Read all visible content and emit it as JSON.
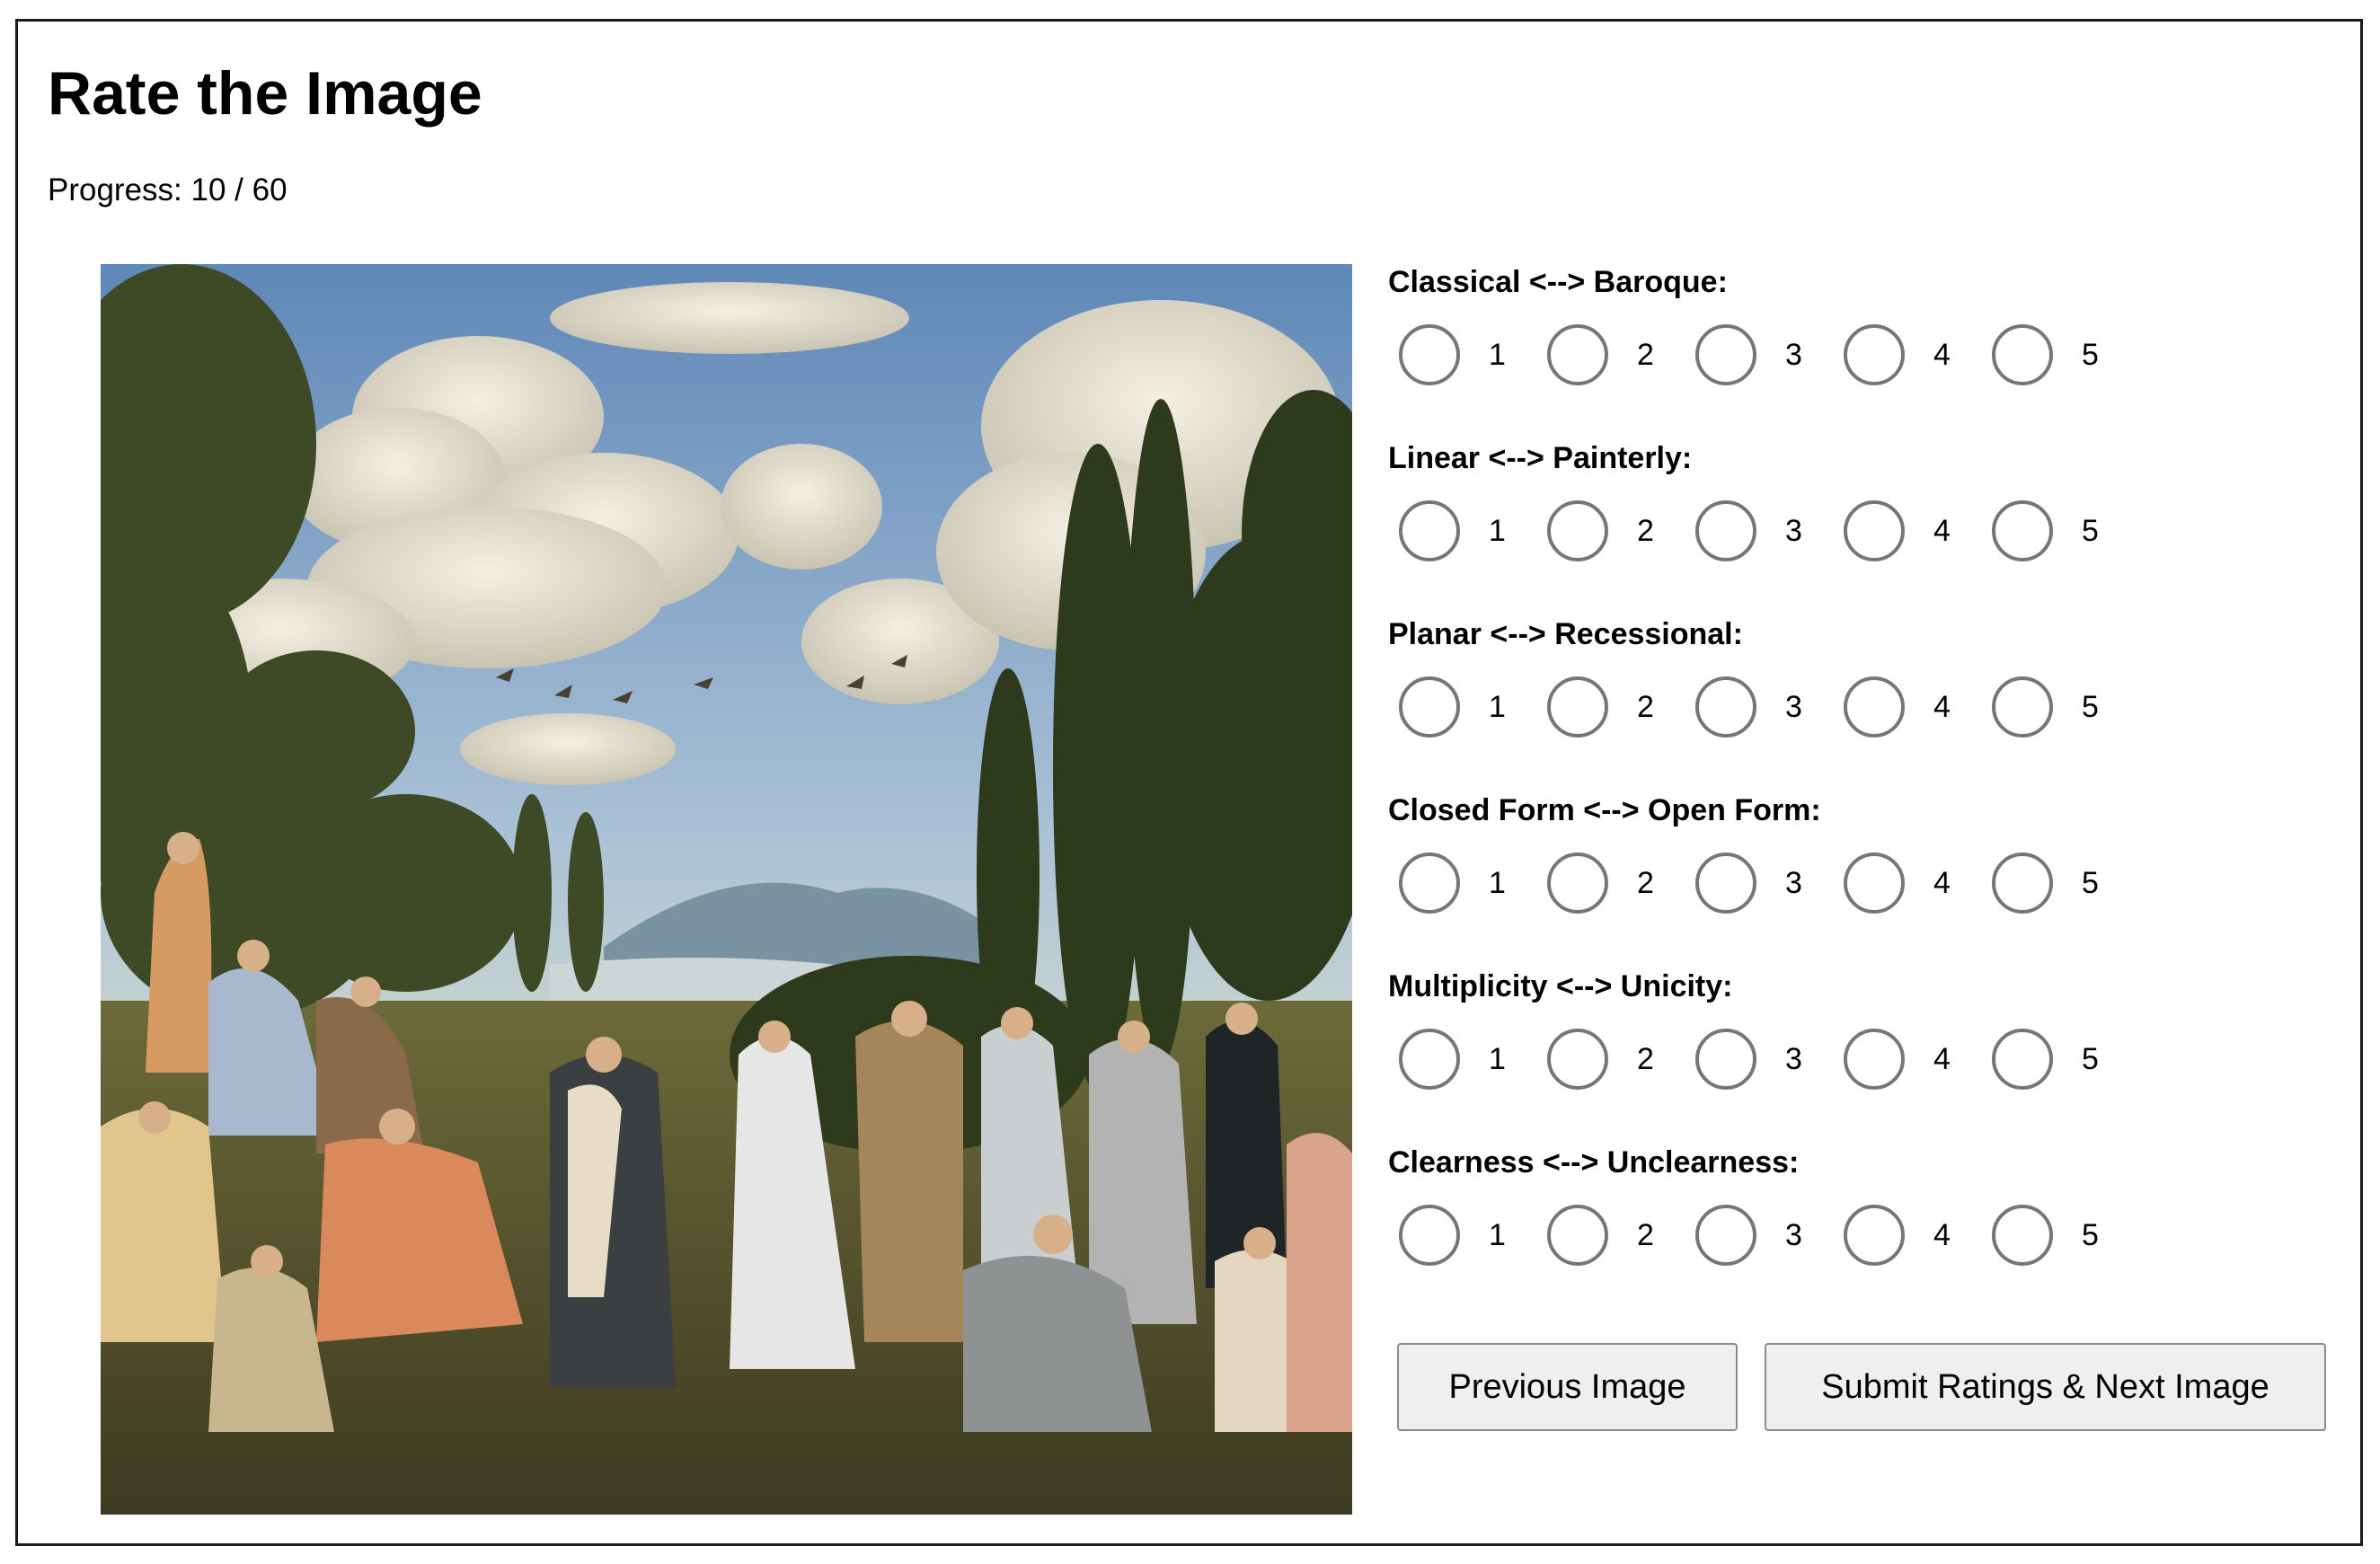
{
  "page": {
    "title": "Rate the Image",
    "progress": "Progress: 10 / 60"
  },
  "image": {
    "description_icon": "renaissance-landscape-painting"
  },
  "ratings": [
    {
      "label": "Classical <--> Baroque:",
      "options": [
        "1",
        "2",
        "3",
        "4",
        "5"
      ],
      "selected": null
    },
    {
      "label": "Linear <--> Painterly:",
      "options": [
        "1",
        "2",
        "3",
        "4",
        "5"
      ],
      "selected": null
    },
    {
      "label": "Planar <--> Recessional:",
      "options": [
        "1",
        "2",
        "3",
        "4",
        "5"
      ],
      "selected": null
    },
    {
      "label": "Closed Form <--> Open Form:",
      "options": [
        "1",
        "2",
        "3",
        "4",
        "5"
      ],
      "selected": null
    },
    {
      "label": "Multiplicity <--> Unicity:",
      "options": [
        "1",
        "2",
        "3",
        "4",
        "5"
      ],
      "selected": null
    },
    {
      "label": "Clearness <--> Unclearness:",
      "options": [
        "1",
        "2",
        "3",
        "4",
        "5"
      ],
      "selected": null
    }
  ],
  "buttons": {
    "previous": "Previous Image",
    "submit": "Submit Ratings & Next Image"
  },
  "colors": {
    "button_bg": "#efefef",
    "button_border": "#8c8c8c",
    "radio_border": "#767676"
  }
}
